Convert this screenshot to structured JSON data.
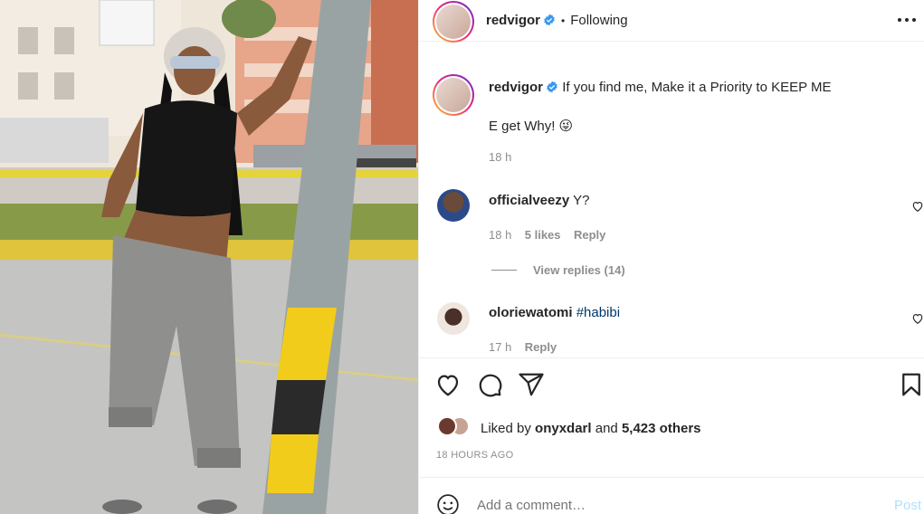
{
  "header": {
    "username": "redvigor",
    "separator": "•",
    "follow_status": "Following"
  },
  "caption": {
    "username": "redvigor",
    "text": "If you find me, Make it a Priority to KEEP ME",
    "line2": "E get Why! 😜",
    "time": "18 h"
  },
  "comments": [
    {
      "username": "officialveezy",
      "text": "Y?",
      "time": "18 h",
      "likes": "5 likes",
      "reply_label": "Reply",
      "view_replies": "View replies (14)"
    },
    {
      "username": "oloriewatomi",
      "text": "#habibi",
      "time": "17 h",
      "reply_label": "Reply"
    }
  ],
  "likes_line": {
    "prefix": "Liked by ",
    "user": "onyxdarl",
    "middle": " and ",
    "others": "5,423 others"
  },
  "post_time": "18 HOURS AGO",
  "add_comment": {
    "placeholder": "Add a comment…",
    "post_label": "Post"
  },
  "colors": {
    "verified": "#3897f0",
    "muted": "#8e8e8e",
    "post_button": "#b2dffc",
    "hashtag": "#00376b"
  },
  "icons": [
    "more-icon",
    "verified-icon",
    "heart-icon",
    "comment-icon",
    "share-icon",
    "bookmark-icon",
    "emoji-icon"
  ]
}
